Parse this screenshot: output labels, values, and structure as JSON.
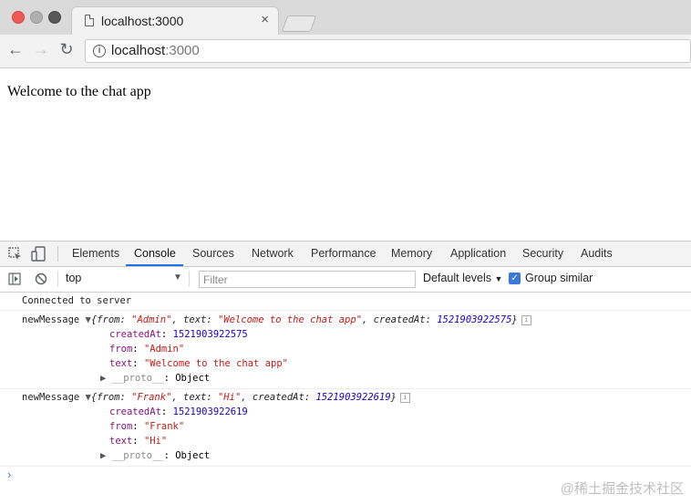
{
  "browser": {
    "tab_title": "localhost:3000",
    "close_glyph": "×",
    "url_host": "localhost",
    "url_port": ":3000",
    "nav": {
      "back": "←",
      "forward": "→",
      "reload": "↻"
    },
    "colors": {
      "close": "#ee5b55",
      "minimize": "#b0b0b0",
      "maximize": "#575757"
    }
  },
  "page": {
    "text": "Welcome to the chat app"
  },
  "devtools": {
    "tabs": [
      "Elements",
      "Console",
      "Sources",
      "Network",
      "Performance",
      "Memory",
      "Application",
      "Security",
      "Audits"
    ],
    "active_tab": "Console",
    "context": "top",
    "filter_placeholder": "Filter",
    "levels_label": "Default levels",
    "group_similar_label": "Group similar",
    "group_similar_checked": true,
    "console": {
      "connected": "Connected to server",
      "messages": [
        {
          "label": "newMessage",
          "summary_from": "\"Admin\"",
          "summary_text": "\"Welcome to the chat app\"",
          "summary_createdAt": "1521903922575",
          "createdAt": "1521903922575",
          "from": "\"Admin\"",
          "text": "\"Welcome to the chat app\"",
          "proto": "Object"
        },
        {
          "label": "newMessage",
          "summary_from": "\"Frank\"",
          "summary_text": "\"Hi\"",
          "summary_createdAt": "1521903922619",
          "createdAt": "1521903922619",
          "from": "\"Frank\"",
          "text": "\"Hi\"",
          "proto": "Object"
        }
      ],
      "prompt": "›"
    }
  },
  "watermark": "@稀土掘金技术社区"
}
